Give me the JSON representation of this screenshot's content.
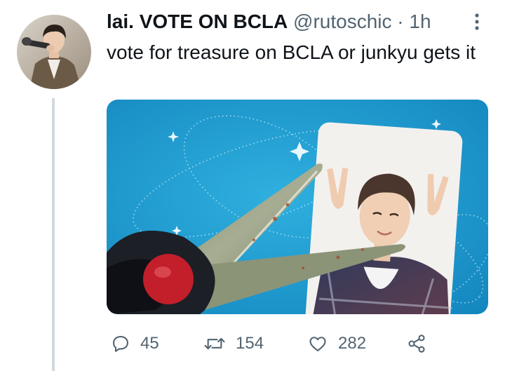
{
  "tweet": {
    "display_name": "lai. VOTE ON BCLA",
    "handle": "@rutoschic",
    "separator": "·",
    "timestamp": "1h",
    "text": "vote for treasure on BCLA or junkyu gets it"
  },
  "avatar": {
    "icon": "profile-photo"
  },
  "media": {
    "icon": "tweet-photo"
  },
  "actions": {
    "reply_count": "45",
    "retweet_count": "154",
    "like_count": "282",
    "icons": [
      "reply-icon",
      "retweet-icon",
      "like-icon",
      "share-icon"
    ]
  },
  "colors": {
    "text_primary": "#0f1419",
    "text_secondary": "#536471",
    "thread_line": "#cfd9de"
  }
}
